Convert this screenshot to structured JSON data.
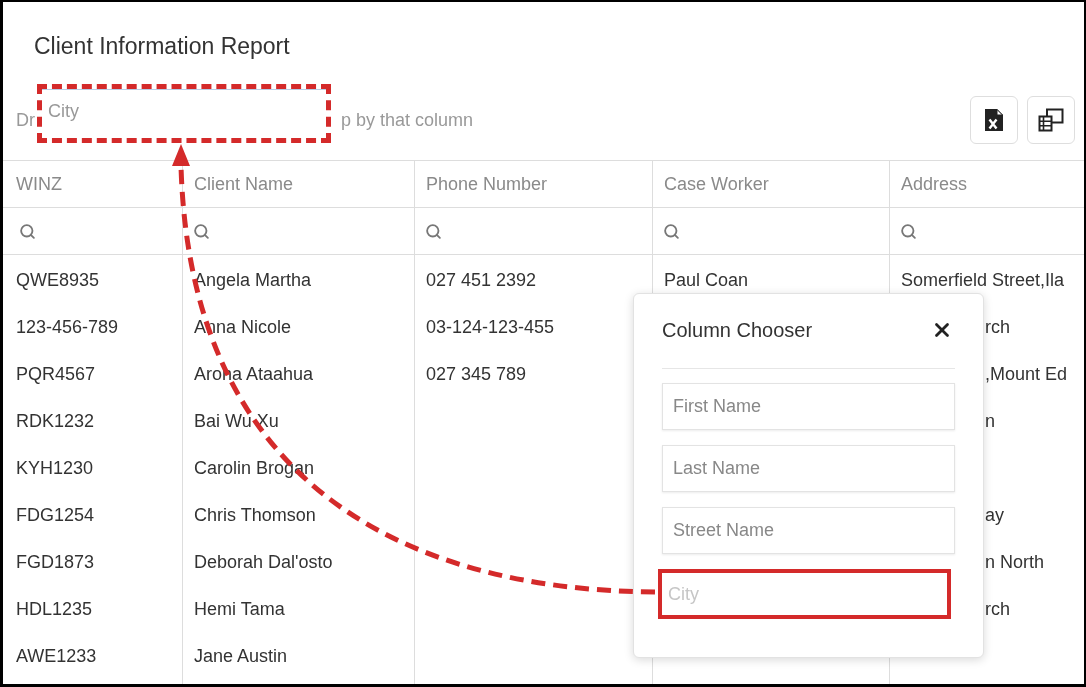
{
  "report": {
    "title": "Client Information Report"
  },
  "group_panel": {
    "hint_before": "Dr",
    "hint_after": "p by that column",
    "dragged_item": {
      "label": "City"
    }
  },
  "table": {
    "columns": [
      "WINZ",
      "Client Name",
      "Phone Number",
      "Case Worker",
      "Address"
    ],
    "rows": [
      {
        "winz": "QWE8935",
        "client_name": "Angela Martha",
        "phone_number": "027 451 2392",
        "case_worker": "Paul Coan",
        "address": {
          "text": "Somerfield Street,Ila",
          "partly_hidden": false
        }
      },
      {
        "winz": "123-456-789",
        "client_name": "Anna Nicole",
        "phone_number": "03-124-123-455",
        "address": {
          "text": "rch",
          "partly_hidden": true
        }
      },
      {
        "winz": "PQR4567",
        "client_name": "Aroha Ataahua",
        "phone_number": "027 345 789",
        "address": {
          "text": ",Mount Ed",
          "partly_hidden": true
        }
      },
      {
        "winz": "RDK1232",
        "client_name": "Bai Wu Xu",
        "address": {
          "text": "n",
          "partly_hidden": true
        }
      },
      {
        "winz": "KYH1230",
        "client_name": "Carolin Brogan"
      },
      {
        "winz": "FDG1254",
        "client_name": "Chris Thomson",
        "address": {
          "text": "ay",
          "partly_hidden": true
        }
      },
      {
        "winz": "FGD1873",
        "client_name": "Deborah Dal'osto",
        "address": {
          "text": "n North",
          "partly_hidden": true
        }
      },
      {
        "winz": "HDL1235",
        "client_name": "Hemi Tama",
        "address": {
          "text": "rch",
          "partly_hidden": true
        }
      },
      {
        "winz": "AWE1233",
        "client_name": "Jane Austin"
      }
    ]
  },
  "column_chooser": {
    "title": "Column Chooser",
    "items": [
      {
        "label": "First Name",
        "dragging": false
      },
      {
        "label": "Last Name",
        "dragging": false
      },
      {
        "label": "Street Name",
        "dragging": false
      },
      {
        "label": "City",
        "dragging": true
      }
    ]
  }
}
